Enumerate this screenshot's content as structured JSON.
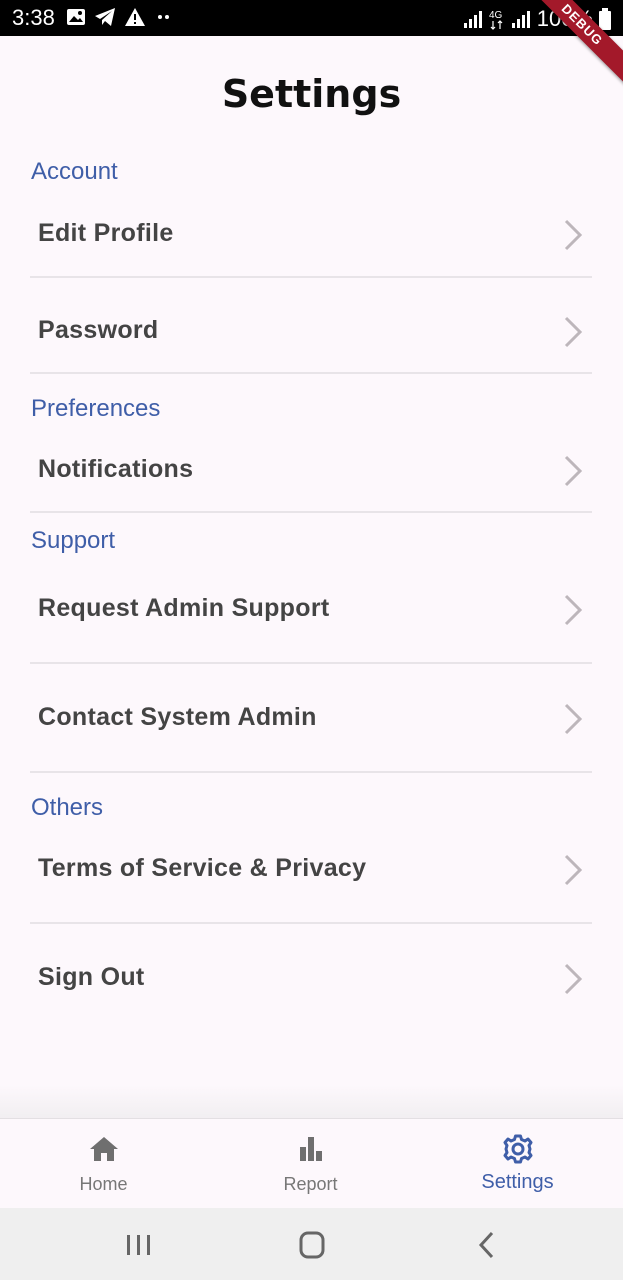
{
  "status_bar": {
    "time": "3:38",
    "battery": "100%",
    "network": "4G",
    "debug_label": "DEBUG"
  },
  "page": {
    "title": "Settings"
  },
  "sections": [
    {
      "header": "Account",
      "items": [
        "Edit Profile",
        "Password"
      ]
    },
    {
      "header": "Preferences",
      "items": [
        "Notifications"
      ]
    },
    {
      "header": "Support",
      "items": [
        "Request Admin Support",
        "Contact System Admin"
      ]
    },
    {
      "header": "Others",
      "items": [
        "Terms of Service & Privacy",
        "Sign Out"
      ]
    }
  ],
  "bottom_nav": {
    "items": [
      {
        "label": "Home",
        "icon": "home-icon",
        "active": false
      },
      {
        "label": "Report",
        "icon": "bar-chart-icon",
        "active": false
      },
      {
        "label": "Settings",
        "icon": "gear-icon",
        "active": true
      }
    ]
  },
  "colors": {
    "accent": "#3f5ea8",
    "background": "#fdf8fc",
    "debug_banner": "#a3192a"
  }
}
